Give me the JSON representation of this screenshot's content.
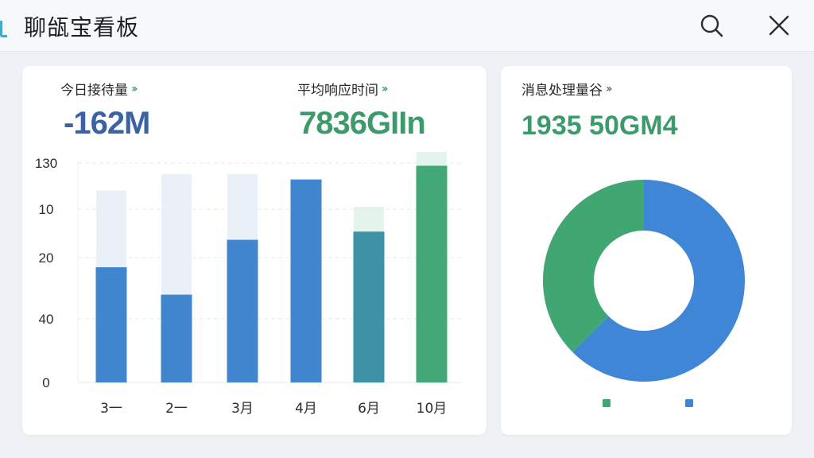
{
  "app": {
    "title": "聊瓵宝看板",
    "accent_color": "#45a8c9"
  },
  "toolbar": {
    "search_icon": "search-icon",
    "close_icon": "close-icon"
  },
  "metrics": [
    {
      "label": "今日接待量",
      "value": "-162M",
      "color": "#3a62a5"
    },
    {
      "label": "平均响应时间",
      "value": "7836GIIn",
      "color": "#3d9a6b"
    },
    {
      "label": "消息处理量谷",
      "value": "1935  50GM4",
      "color": "#3d9a6b"
    }
  ],
  "chart_data": [
    {
      "type": "bar",
      "categories": [
        "3一",
        "2一",
        "3月",
        "4月",
        "6月",
        "10月"
      ],
      "y_tick_labels": [
        "0",
        "40",
        "20",
        "10",
        "130"
      ],
      "series": [
        {
          "values": [
            42,
            32,
            52,
            74,
            55,
            79
          ]
        },
        {
          "values": [
            28,
            44,
            24,
            0,
            9,
            5
          ]
        }
      ],
      "stacked": true,
      "grid": true,
      "colors": {
        "primary": "#3f86cf",
        "last_primary": "#43a877",
        "transition_primary": "#3d93a5",
        "background": "#e9f0f8",
        "background_green": "#e4f3ec"
      }
    },
    {
      "type": "pie",
      "donut": true,
      "slices": [
        {
          "value": 62.5,
          "color": "#3f86d6"
        },
        {
          "value": 37.5,
          "color": "#40a672"
        }
      ]
    }
  ]
}
